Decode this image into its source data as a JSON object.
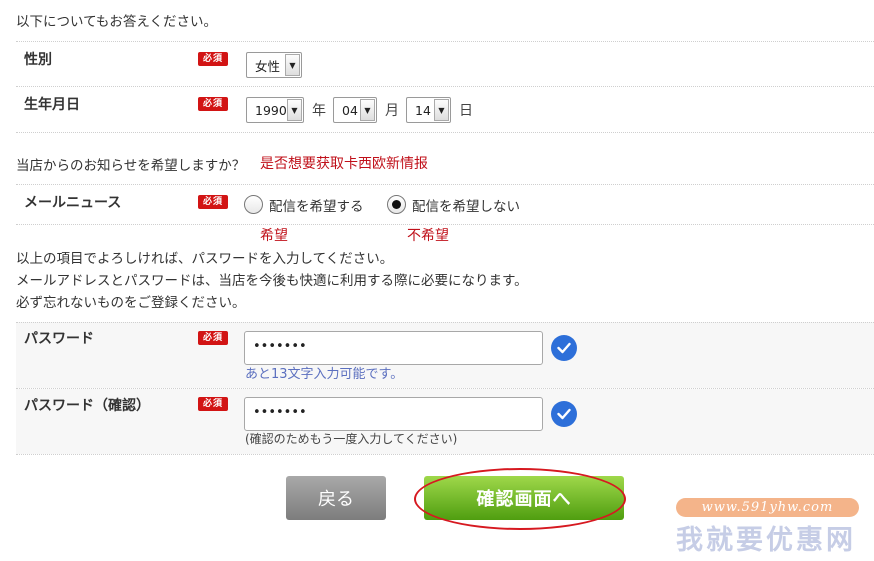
{
  "intro": "以下についてもお答えください。",
  "required_badge": "必須",
  "gender": {
    "label": "性別",
    "value": "女性"
  },
  "birthdate": {
    "label": "生年月日",
    "year": "1990",
    "year_unit": "年",
    "month": "04",
    "month_unit": "月",
    "day": "14",
    "day_unit": "日"
  },
  "newsletter_question": "当店からのお知らせを希望しますか？",
  "newsletter_question_note": "是否想要获取卡西欧新情报",
  "mail_news": {
    "label": "メールニュース",
    "option_yes": "配信を希望する",
    "option_yes_note": "希望",
    "option_no": "配信を希望しない",
    "option_no_note": "不希望",
    "selected": "no"
  },
  "instructions": [
    "以上の項目でよろしければ、パスワードを入力してください。",
    "メールアドレスとパスワードは、当店を今後も快適に利用する際に必要になります。",
    "必ず忘れないものをご登録ください。"
  ],
  "password": {
    "label": "パスワード",
    "value": "•••••••",
    "hint": "あと13文字入力可能です。"
  },
  "password_confirm": {
    "label": "パスワード（確認）",
    "value": "•••••••",
    "hint": "(確認のためもう一度入力してください)"
  },
  "buttons": {
    "back": "戻る",
    "confirm": "確認画面へ"
  },
  "watermark": {
    "url": "www.591yhw.com",
    "name": "我就要优惠网"
  },
  "colors": {
    "required": "#d21414",
    "confirm": "#5aa716",
    "check": "#2d6fd9",
    "annotation": "#c0101a"
  }
}
